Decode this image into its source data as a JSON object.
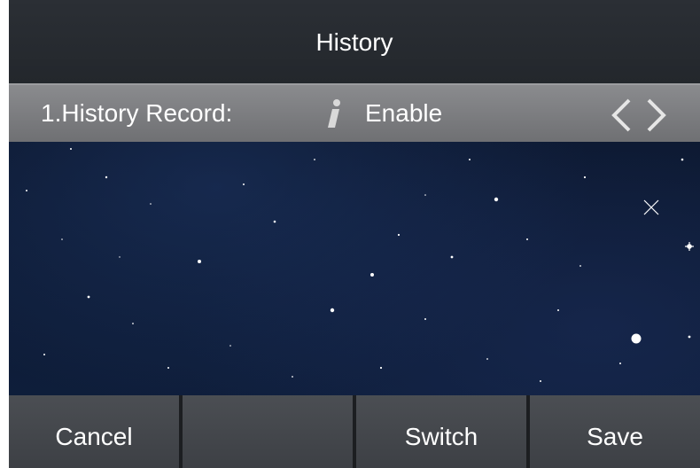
{
  "header": {
    "title": "History"
  },
  "setting": {
    "label": "1.History Record:",
    "value": "Enable",
    "info_icon": "info-icon",
    "prev_icon": "chevron-left-icon",
    "next_icon": "chevron-right-icon"
  },
  "softkeys": [
    {
      "label": "Cancel"
    },
    {
      "label": ""
    },
    {
      "label": "Switch"
    },
    {
      "label": "Save"
    }
  ],
  "colors": {
    "titlebar": "#2b2f35",
    "selected_row": "#7c7d80",
    "softkey": "#45484d",
    "background": "#0d1a33",
    "text": "#ffffff"
  }
}
